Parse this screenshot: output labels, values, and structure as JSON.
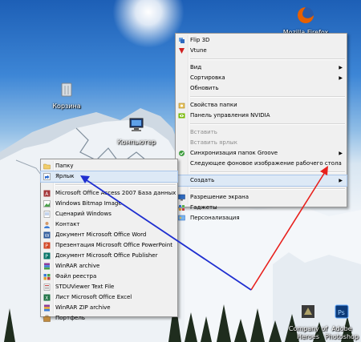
{
  "desktop": {
    "icons": [
      {
        "label": "Mozilla Firefox",
        "icon": "firefox-icon"
      },
      {
        "label": "Корзина",
        "icon": "recycle-bin-icon"
      },
      {
        "label": "Компьютер",
        "icon": "computer-icon"
      },
      {
        "label": "Company of Heroes",
        "icon": "game-icon"
      },
      {
        "label": "Adobe Photoshop",
        "icon": "photoshop-icon"
      }
    ]
  },
  "context_menu": {
    "items": [
      {
        "label": "Flip 3D",
        "icon": "flip3d-icon"
      },
      {
        "label": "Vtune",
        "icon": "vtune-icon"
      },
      {
        "label": "Вид"
      },
      {
        "label": "Сортировка"
      },
      {
        "label": "Обновить"
      },
      {
        "label": "Свойства папки",
        "icon": "folder-options-icon"
      },
      {
        "label": "Панель управления NVIDIA",
        "icon": "nvidia-icon"
      },
      {
        "label": "Вставить"
      },
      {
        "label": "Вставить ярлык"
      },
      {
        "label": "Синхронизация папок Groove",
        "icon": "groove-icon"
      },
      {
        "label": "Следующее фоновое изображение рабочего стола"
      },
      {
        "label": "Создать"
      },
      {
        "label": "Разрешение экрана",
        "icon": "screen-resolution-icon"
      },
      {
        "label": "Гаджеты",
        "icon": "gadgets-icon"
      },
      {
        "label": "Персонализация",
        "icon": "personalization-icon"
      }
    ]
  },
  "create_submenu": {
    "items": [
      {
        "label": "Папку",
        "icon": "folder-icon"
      },
      {
        "label": "Ярлык",
        "icon": "shortcut-icon"
      },
      {
        "label": "Microsoft Office Access 2007 База данных",
        "icon": "access-icon"
      },
      {
        "label": "Windows Bitmap Image",
        "icon": "bitmap-icon"
      },
      {
        "label": "Сценарий Windows",
        "icon": "script-icon"
      },
      {
        "label": "Контакт",
        "icon": "contact-icon"
      },
      {
        "label": "Документ Microsoft Office Word",
        "icon": "word-icon"
      },
      {
        "label": "Презентация Microsoft Office PowerPoint",
        "icon": "powerpoint-icon"
      },
      {
        "label": "Документ Microsoft Office Publisher",
        "icon": "publisher-icon"
      },
      {
        "label": "WinRAR archive",
        "icon": "winrar-icon"
      },
      {
        "label": "Файл реестра",
        "icon": "registry-icon"
      },
      {
        "label": "STDUViewer Text File",
        "icon": "stdu-icon"
      },
      {
        "label": "Лист Microsoft Office Excel",
        "icon": "excel-icon"
      },
      {
        "label": "WinRAR ZIP archive",
        "icon": "winrar-zip-icon"
      },
      {
        "label": "Портфель",
        "icon": "briefcase-icon"
      }
    ]
  },
  "colors": {
    "highlight": "#dde9f6",
    "arrow_red": "#e8201c",
    "arrow_blue": "#1f2fd0"
  }
}
